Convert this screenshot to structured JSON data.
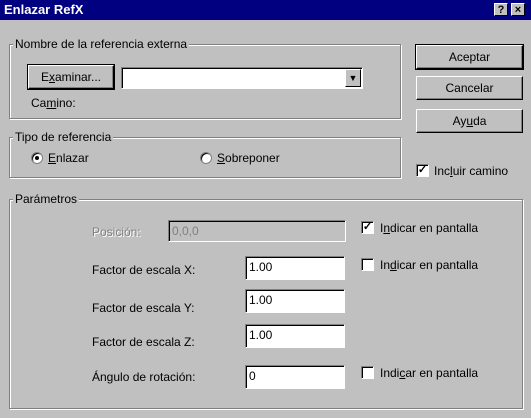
{
  "window": {
    "title": "Enlazar RefX",
    "help_button": "?",
    "close_button": "×"
  },
  "external_ref": {
    "group_label": "Nombre de la referencia externa",
    "browse_pre": "E",
    "browse_u": "x",
    "browse_post": "aminar...",
    "name_value": "",
    "path_pre": "Ca",
    "path_u": "m",
    "path_post": "ino:"
  },
  "reference_type": {
    "group_label": "Tipo de referencia",
    "attach_u": "E",
    "attach_post": "nlazar",
    "attach_selected": true,
    "overlay_u": "S",
    "overlay_post": "obreponer",
    "overlay_selected": false
  },
  "buttons": {
    "ok": "Aceptar",
    "cancel": "Cancelar",
    "help_pre": "Ay",
    "help_u": "u",
    "help_post": "da"
  },
  "include_path": {
    "pre": "Inc",
    "u": "l",
    "post": "uir camino",
    "checked": "✓"
  },
  "parameters": {
    "group_label": "Parámetros",
    "position_label": "Posición:",
    "position_value": "0,0,0",
    "position_onscreen": {
      "pre": "I",
      "u": "n",
      "post": "dicar en pantalla",
      "checked": "✓"
    },
    "scale_x_label": "Factor de escala X:",
    "scale_x_value": "1.00",
    "scale_onscreen": {
      "pre": "In",
      "u": "d",
      "post": "icar en pantalla",
      "checked": ""
    },
    "scale_y_label": "Factor de escala Y:",
    "scale_y_value": "1.00",
    "scale_z_label": "Factor de escala Z:",
    "scale_z_value": "1.00",
    "rotation_label": "Ángulo de rotación:",
    "rotation_value": "0",
    "rotation_onscreen": {
      "pre": "Indi",
      "u": "c",
      "post": "ar en pantalla",
      "checked": ""
    }
  }
}
